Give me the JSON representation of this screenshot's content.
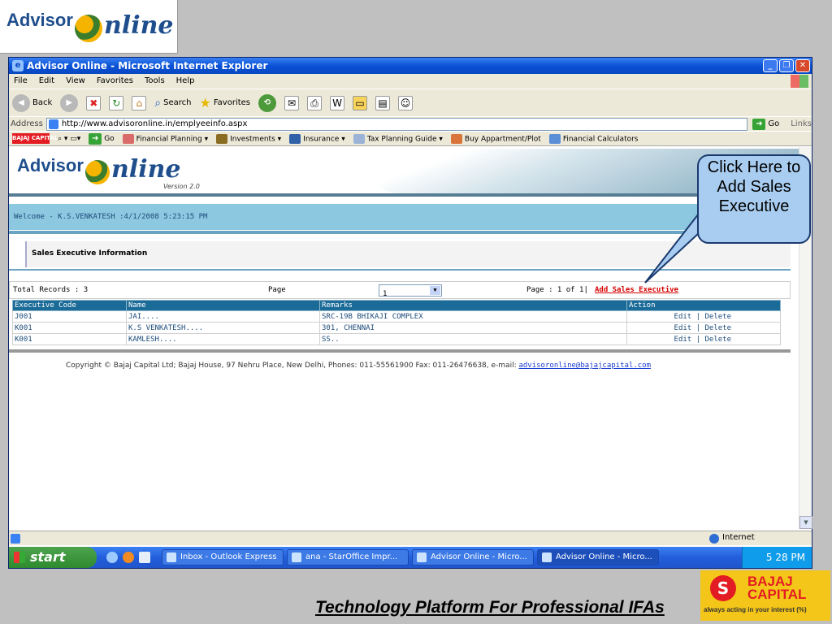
{
  "slide": {
    "logo_advisor": "Advisor",
    "logo_online": "nline",
    "tagline": "Technology Platform For Professional IFAs",
    "bajaj_line1": "BAJAJ",
    "bajaj_line2": "CAPITAL",
    "bajaj_tagline": "always acting in your interest (%)"
  },
  "window": {
    "title": "Advisor Online - Microsoft Internet Explorer",
    "menu": [
      "File",
      "Edit",
      "View",
      "Favorites",
      "Tools",
      "Help"
    ],
    "toolbar": {
      "back": "Back",
      "search": "Search",
      "favorites": "Favorites"
    },
    "address_label": "Address",
    "address_url": "http://www.advisoronline.in/emplyeeinfo.aspx",
    "go_label": "Go",
    "links_label": "Links",
    "links_bar": {
      "go": "Go",
      "items": [
        "Financial Planning",
        "Investments",
        "Insurance",
        "Tax Planning Guide",
        "Buy Appartment/Plot",
        "Financial Calculators"
      ]
    },
    "status_zone": "Internet"
  },
  "site": {
    "logo_advisor": "Advisor",
    "logo_online": "nline",
    "version": "Version 2.0",
    "welcome": "Welcome - K.S.VENKATESH :4/1/2008 5:23:15 PM",
    "section_title": "Sales Executive Information",
    "total_records": "Total Records : 3",
    "page_label": "Page",
    "page_selected": "1",
    "page_of": "Page : 1 of 1|",
    "add_link": "Add Sales Executive",
    "table": {
      "headers": [
        "Executive Code",
        "Name",
        "Remarks",
        "Action"
      ],
      "rows": [
        {
          "code": "J001",
          "name": "JAI....",
          "remarks": "SRC-19B BHIKAJI COMPLEX",
          "edit": "Edit",
          "delete": "Delete"
        },
        {
          "code": "K001",
          "name": "K.S VENKATESH....",
          "remarks": "301, CHENNAI",
          "edit": "Edit",
          "delete": "Delete"
        },
        {
          "code": "K001",
          "name": "KAMLESH....",
          "remarks": "SS..",
          "edit": "Edit",
          "delete": "Delete"
        }
      ]
    },
    "copyright": "Copyright © Bajaj Capital Ltd; Bajaj House, 97 Nehru Place, New Delhi, Phones: 011-55561900 Fax: 011-26476638, e-mail: ",
    "email": "advisoronline@bajajcapital.com"
  },
  "taskbar": {
    "start": "start",
    "tasks": [
      "Inbox - Outlook Express",
      "ana - StarOffice Impr...",
      "Advisor Online - Micro...",
      "Advisor Online - Micro..."
    ],
    "clock": "5 28 PM"
  },
  "callout": "Click Here to Add Sales Executive"
}
